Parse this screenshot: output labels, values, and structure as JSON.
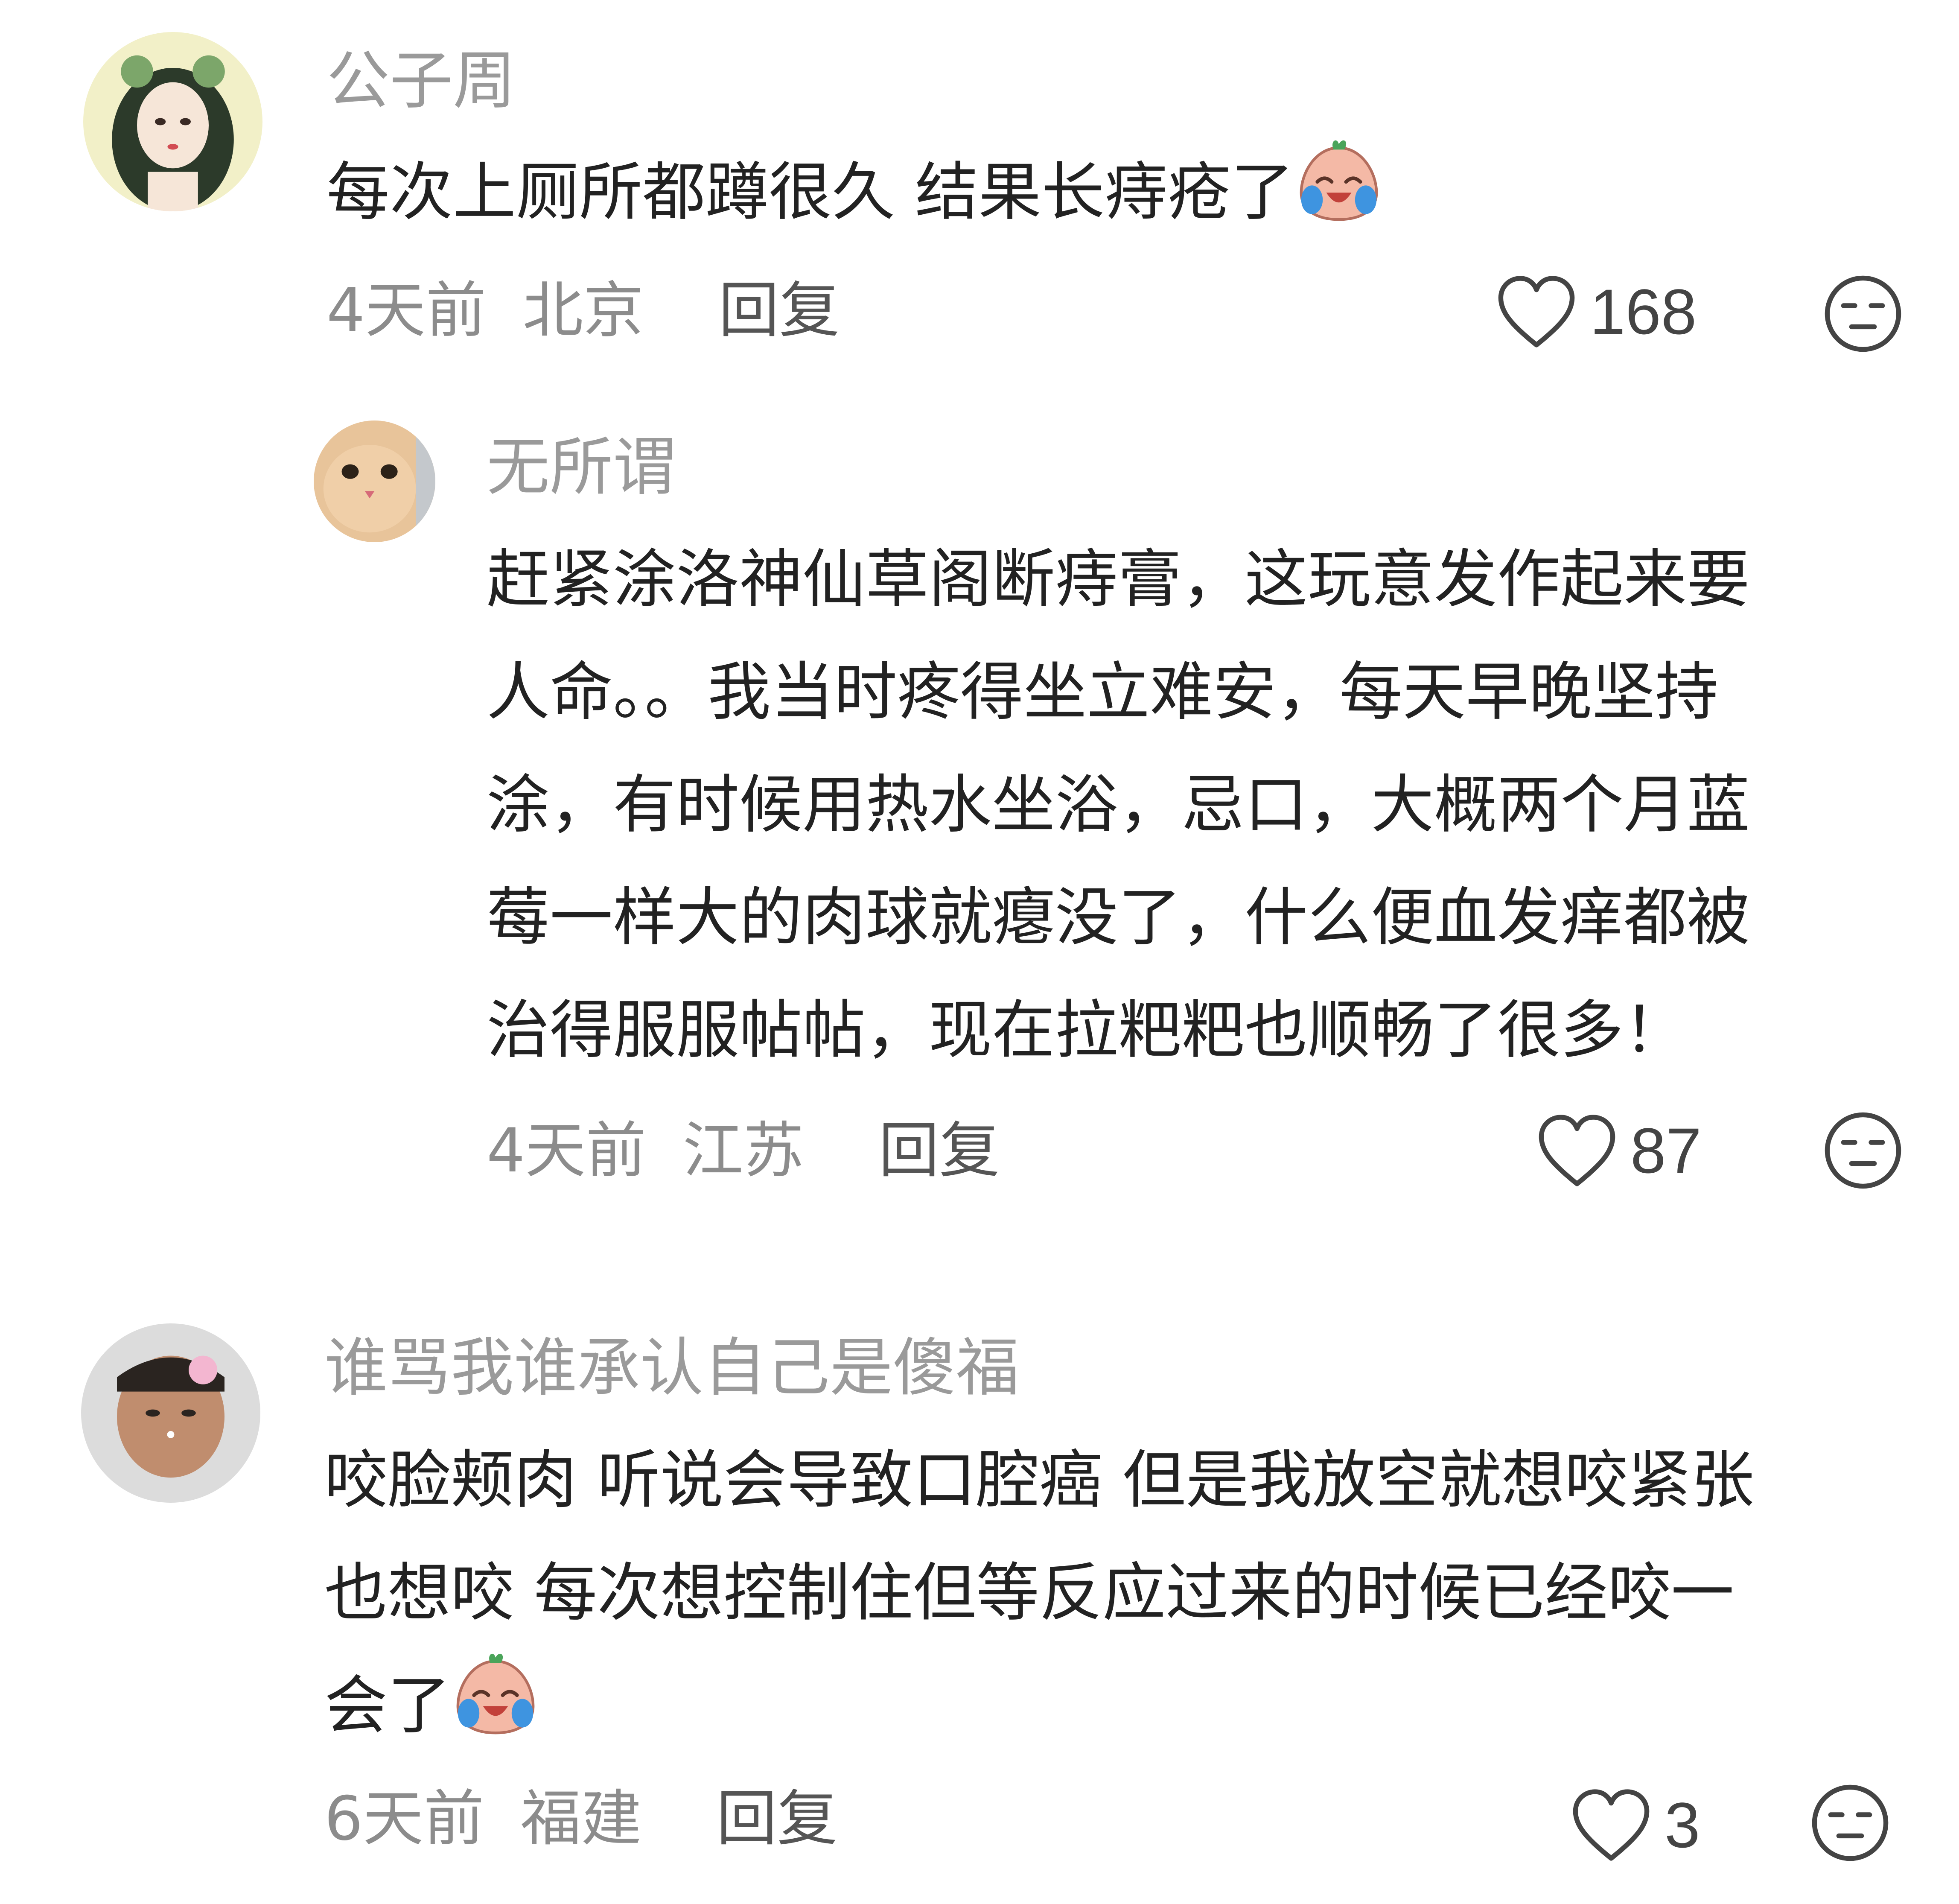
{
  "comments": [
    {
      "username": "公子周",
      "text_lines": [
        "每次上厕所都蹲很久 结果长痔疮了"
      ],
      "emoji": "crying-laughing-emoji",
      "time": "4天前",
      "location": "北京",
      "reply_label": "回复",
      "likes": "168"
    },
    {
      "username": "无所谓",
      "text_lines": [
        "赶紧涂洛神仙草阁断痔膏，这玩意发作起来要",
        "人命。。我当时疼得坐立难安，每天早晚坚持",
        "涂，有时候用热水坐浴，忌口，大概两个月蓝",
        "莓一样大的肉球就瘪没了，什么便血发痒都被",
        "治得服服帖帖，现在拉粑粑也顺畅了很多！"
      ],
      "time": "4天前",
      "location": "江苏",
      "reply_label": "回复",
      "likes": "87"
    },
    {
      "username": "谁骂我谁承认自己是傻福",
      "text_lines": [
        "咬脸颊肉 听说会导致口腔癌 但是我放空就想咬紧张",
        "也想咬 每次想控制住但等反应过来的时候已经咬一",
        "会了"
      ],
      "emoji": "crying-laughing-emoji",
      "time": "6天前",
      "location": "福建",
      "reply_label": "回复",
      "likes": "3"
    }
  ],
  "colors": {
    "username": "#9a9a9a",
    "text": "#222222",
    "meta": "#8c8c8c",
    "reply": "#555555",
    "icon": "#444444"
  }
}
